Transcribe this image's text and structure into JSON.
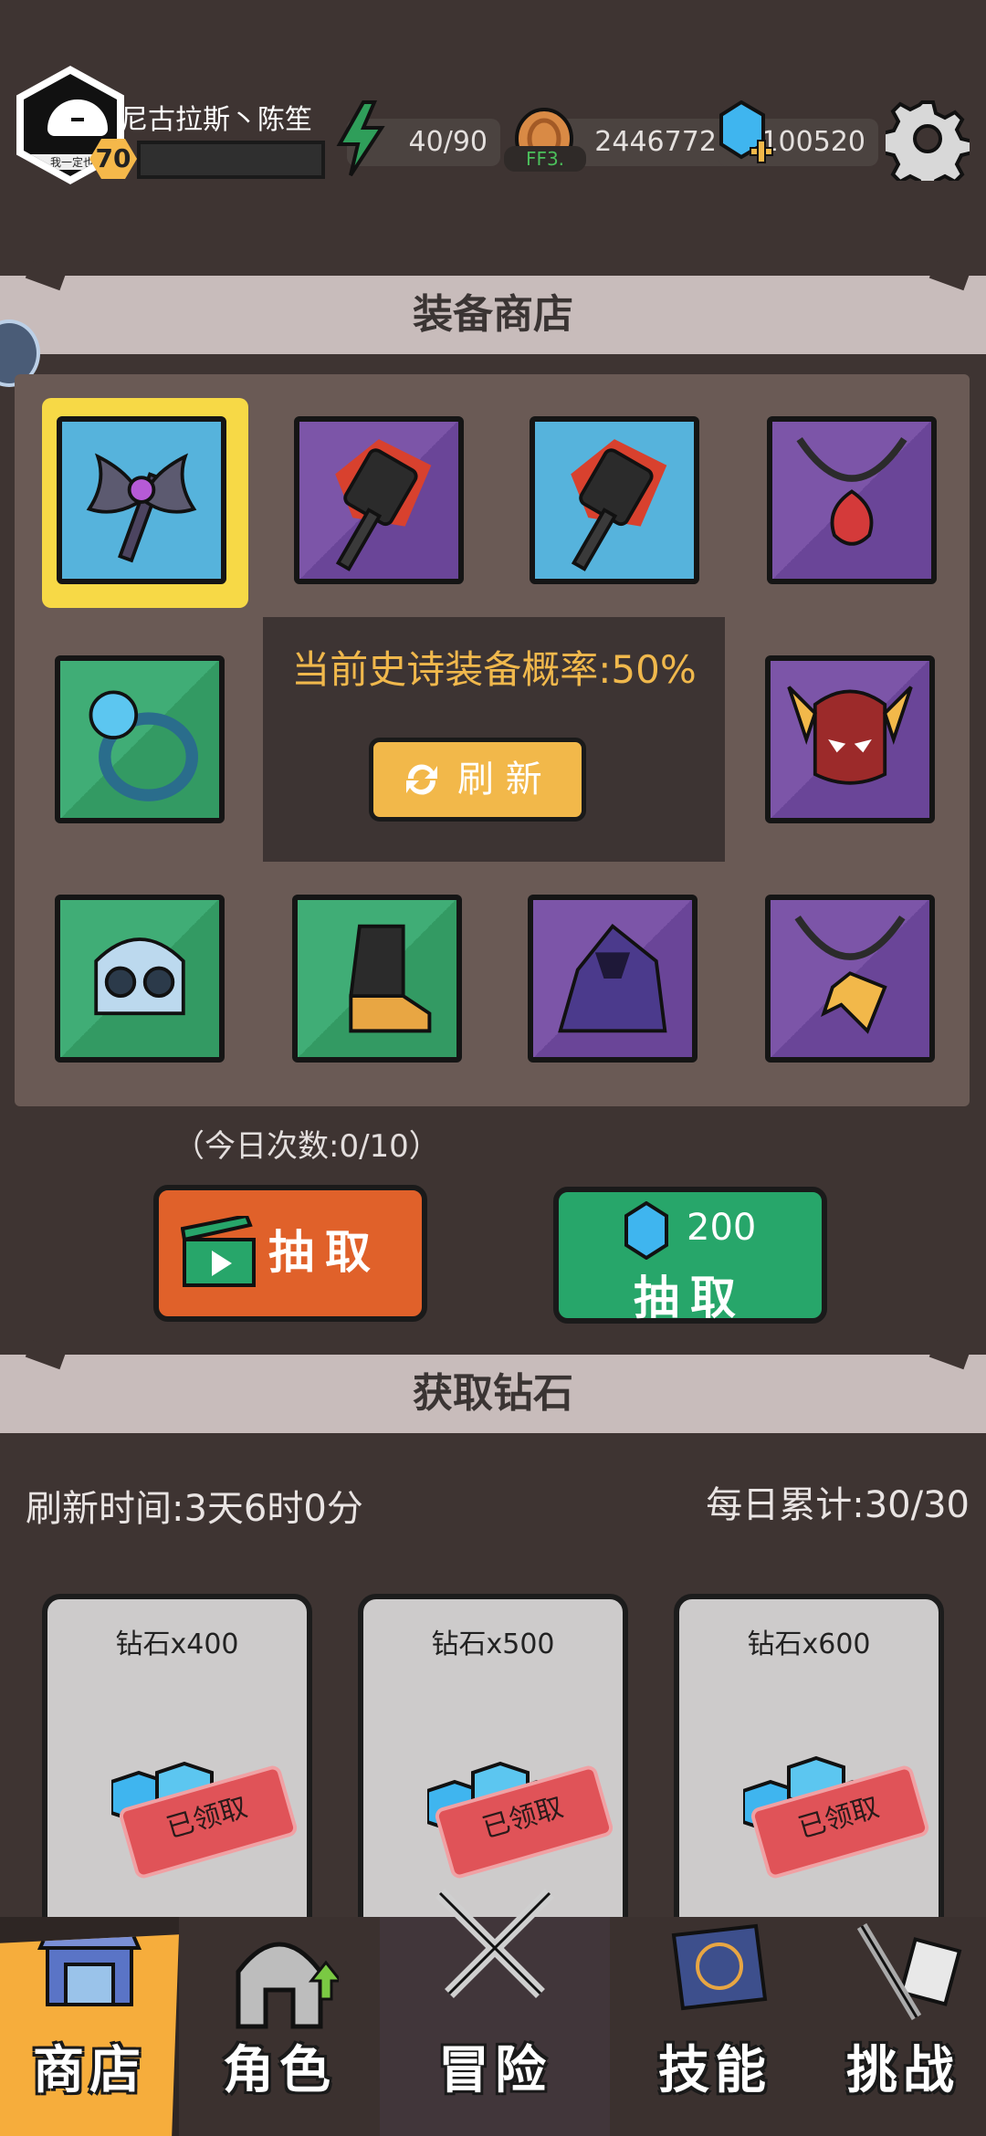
{
  "player": {
    "name": "尼古拉斯丶陈笙",
    "level": "70",
    "avatar_caption": "我一定也能"
  },
  "resources": {
    "energy": "40/90",
    "coins": "24467722",
    "coin_tag": "FF3.",
    "gems": "100520"
  },
  "equipment_shop": {
    "title": "装备商店",
    "epic_rate_text": "当前史诗装备概率:50%",
    "refresh_label": "刷 新",
    "daily_count": "（今日次数:0/10）",
    "draw_ad_label": "抽取",
    "draw_gem_cost": "200",
    "draw_gem_label": "抽取",
    "items": [
      {
        "name": "dark-axe",
        "rarity": "blue",
        "selected": true
      },
      {
        "name": "flame-hammer",
        "rarity": "purple"
      },
      {
        "name": "flame-hammer",
        "rarity": "blue"
      },
      {
        "name": "heart-necklace",
        "rarity": "purple"
      },
      {
        "name": "crystal-ring",
        "rarity": "green"
      },
      {
        "name": "winged-helmet",
        "rarity": "purple"
      },
      {
        "name": "frost-helmet",
        "rarity": "green"
      },
      {
        "name": "golden-boot",
        "rarity": "green"
      },
      {
        "name": "shadow-cloak",
        "rarity": "purple"
      },
      {
        "name": "lightning-necklace",
        "rarity": "purple"
      }
    ]
  },
  "get_gems": {
    "title": "获取钻石",
    "refresh_time": "刷新时间:3天6时0分",
    "daily_total": "每日累计:30/30",
    "cards": [
      {
        "title": "钻石x400",
        "status": "已领取"
      },
      {
        "title": "钻石x500",
        "status": "已领取"
      },
      {
        "title": "钻石x600",
        "status": "已领取"
      }
    ]
  },
  "nav": {
    "shop": "商店",
    "role": "角色",
    "adventure": "冒险",
    "skill": "技能",
    "challenge": "挑战",
    "active": "shop"
  },
  "colors": {
    "background": "#3e3432",
    "accent_orange": "#e0612a",
    "accent_green": "#27a66a",
    "gold": "#f2b84a",
    "epic_text": "#f0b84c"
  }
}
